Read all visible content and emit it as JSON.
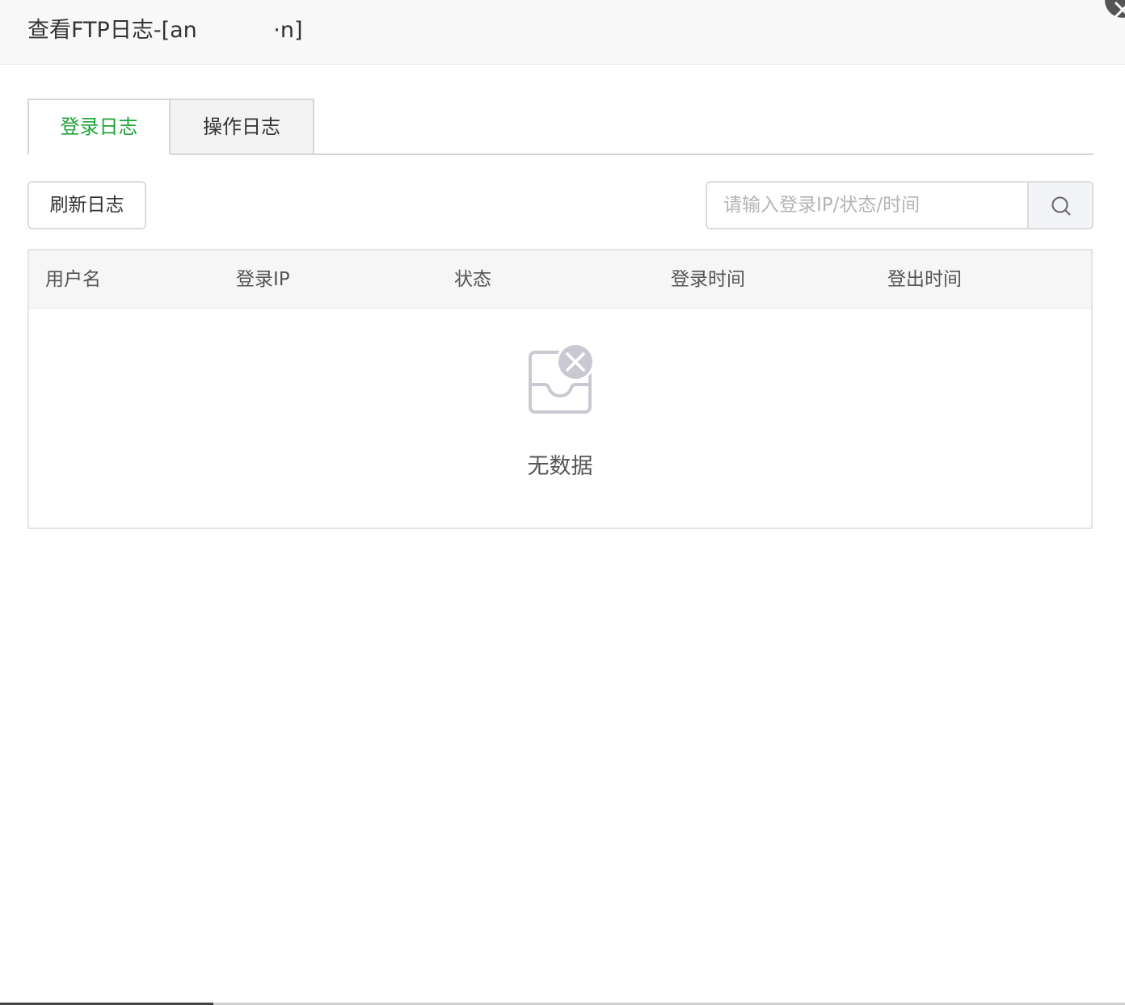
{
  "dialog": {
    "title": "查看FTP日志-[an       ·n]"
  },
  "tabs": [
    {
      "label": "登录日志",
      "active": true
    },
    {
      "label": "操作日志",
      "active": false
    }
  ],
  "toolbar": {
    "refresh_label": "刷新日志",
    "search_placeholder": "请输入登录IP/状态/时间",
    "search_value": ""
  },
  "table": {
    "columns": [
      "用户名",
      "登录IP",
      "状态",
      "登录时间",
      "登出时间"
    ],
    "rows": [],
    "empty_text": "无数据"
  },
  "colors": {
    "accent": "#20a53a",
    "header_bg": "#f6f6f6",
    "border": "#dcdcdc"
  },
  "icons": {
    "close": "close-icon",
    "search": "search-icon",
    "empty": "empty-inbox-icon"
  }
}
